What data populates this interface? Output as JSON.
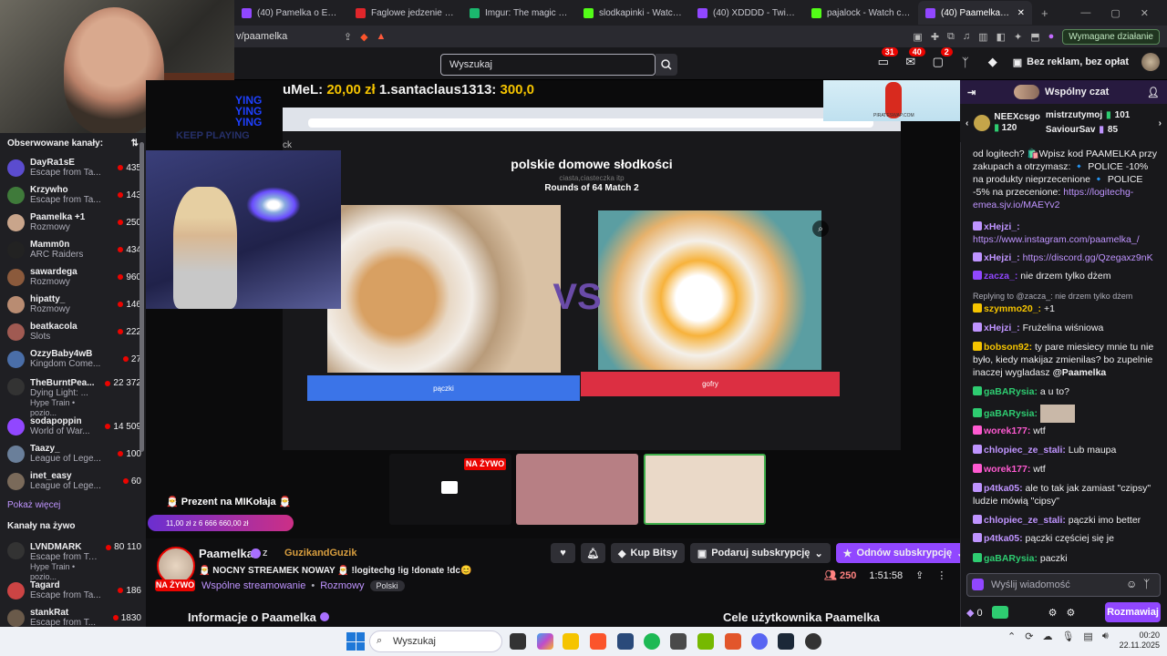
{
  "browser": {
    "tabs": [
      {
        "label": "(40) Pamelka o Ewie - Twit",
        "color": "#9147ff"
      },
      {
        "label": "Faglowe jedzenie | UwUFU",
        "color": "#e0262b"
      },
      {
        "label": "Imgur: The magic of the In",
        "color": "#1bb76e"
      },
      {
        "label": "slodkapinki - Watch clips o",
        "color": "#53fc18"
      },
      {
        "label": "(40) XDDDD - Twitch",
        "color": "#9147ff"
      },
      {
        "label": "pajalock - Watch clips on",
        "color": "#53fc18"
      },
      {
        "label": "(40) Paamelka - Twitch",
        "color": "#9147ff",
        "active": true
      }
    ],
    "new_tab": "+",
    "close": "✕",
    "url": "v/paamelka",
    "required_action": "Wymagane działanie",
    "ext_count": "14"
  },
  "header": {
    "search_placeholder": "Wyszukaj",
    "badge_notifications": "31",
    "badge_inbox": "40",
    "badge_whispers": "2",
    "no_ads": "Bez reklam, bez opłat"
  },
  "sidebar": {
    "followed_title": "Obserwowane kanały:",
    "channels": [
      {
        "name": "DayRa1sE",
        "game": "Escape from Ta...",
        "viewers": "435",
        "color": "#5b4ccf"
      },
      {
        "name": "Krzywho",
        "game": "Escape from Ta...",
        "viewers": "143",
        "color": "#3f7a3a"
      },
      {
        "name": "Paamelka +1",
        "game": "Rozmowy",
        "viewers": "250",
        "color": "#c9a58b"
      },
      {
        "name": "Mamm0n",
        "game": "ARC Raiders",
        "viewers": "434",
        "color": "#222222"
      },
      {
        "name": "sawardega",
        "game": "Rozmowy",
        "viewers": "960",
        "color": "#8b5a3c"
      },
      {
        "name": "hipatty_",
        "game": "Rozmowy",
        "viewers": "146",
        "color": "#b98c72"
      },
      {
        "name": "beatkacola",
        "game": "Slots",
        "viewers": "222",
        "color": "#a05a52"
      },
      {
        "name": "OzzyBaby4wB",
        "game": "Kingdom Come...",
        "viewers": "27",
        "color": "#4a6ea8"
      },
      {
        "name": "TheBurntPea...",
        "game": "Dying Light: ...",
        "viewers": "22 372",
        "color": "#333333",
        "hype": "Hype Train • pozio..."
      },
      {
        "name": "sodapoppin",
        "game": "World of War...",
        "viewers": "14 509",
        "color": "#9147ff"
      },
      {
        "name": "Taazy_",
        "game": "League of Lege...",
        "viewers": "100",
        "color": "#6a7f9a"
      },
      {
        "name": "inet_easy",
        "game": "League of Lege...",
        "viewers": "60",
        "color": "#7a6a5a"
      }
    ],
    "show_more": "Pokaż więcej",
    "live_title": "Kanały na żywo",
    "live_channels": [
      {
        "name": "LVNDMARK",
        "game": "Escape from Ta...",
        "viewers": "80 110",
        "color": "#333333",
        "hype": "Hype Train • pozio..."
      },
      {
        "name": "Tagard",
        "game": "Escape from Ta...",
        "viewers": "186",
        "color": "#c44"
      },
      {
        "name": "stankRat",
        "game": "Escape from T...",
        "viewers": "1830",
        "color": "#6a5a4a"
      }
    ]
  },
  "video": {
    "overlay_top_left": "YING YING YING",
    "keep_playing": "KEEP PLAYING",
    "goal_prefix": "uMeL:",
    "goal_amount1": "20,00 zł",
    "goal_user": "1.santaclaus1313:",
    "goal_amount2": "300,0",
    "ck_label": "ck",
    "page_title": "polskie domowe słodkości",
    "sub_title": "ciasta,ciasteczka itp",
    "round_label": "Rounds of 64 Match 2",
    "vs_label": "VS",
    "left_button": "pączki",
    "right_button": "gofry",
    "live_tag": "NA ŻYWO",
    "gift_label": "🎅 Prezent na MIKołaja 🎅",
    "gift_progress": "11,00 zł z 6 666 660,00 zł",
    "pirate_label": "PIRATESWAP.COM"
  },
  "stream": {
    "name": "Paamelka",
    "with": "z",
    "cohost": "GuzikandGuzik",
    "title": "🎅 NOCNY STREAMEK NOWAY 🎅 !logitechg !ig !donate !dc😊",
    "shared": "Wspólne streamowanie",
    "category": "Rozmowy",
    "tag": "Polski",
    "live_badge": "NA ŻYWO",
    "kup_bitsy": "Kup Bitsy",
    "gift_sub": "Podaruj subskrypcję",
    "renew_sub": "Odnów subskrypcję",
    "viewers": "250",
    "uptime": "1:51:58",
    "about_title": "Informacje o Paamelka",
    "goals_title": "Cele użytkownika Paamelka"
  },
  "chat": {
    "title": "Wspólny czat",
    "leaders": [
      {
        "name": "NEEXcsgo",
        "value": "120"
      },
      {
        "name": "mistrzutymoj",
        "value": "101"
      },
      {
        "name": "SaviourSav",
        "value": "85"
      }
    ],
    "pinned": "od logitech? 🛍️Wpisz kod PAAMELKA przy zakupach a otrzymasz: 🔹 POLICE -10% na produkty nieprzecenione 🔹 POLICE -5% na przecenione:",
    "pinned_link": "https://logitechg-emea.sjv.io/MAEYv2",
    "messages": [
      {
        "user": "xHejzi_:",
        "text": "",
        "link": "https://www.instagram.com/paamelka_/",
        "color": "#bf94ff"
      },
      {
        "user": "xHejzi_:",
        "text": "",
        "link": "https://discord.gg/Qzegaxz9nK",
        "color": "#bf94ff"
      },
      {
        "user": "zacza_:",
        "text": "nie drzem tylko dżem",
        "color": "#9147ff"
      },
      {
        "reply": "Replying to @zacza_: nie drzem tylko dżem"
      },
      {
        "user": "szymmo20_:",
        "text": "+1",
        "color": "#f5c400"
      },
      {
        "user": "xHejzi_:",
        "text": "Frużelina wiśniowa",
        "color": "#bf94ff"
      },
      {
        "user": "bobson92:",
        "text": "ty pare miesiecy mnie tu nie było, kiedy makijaz zmienilas? bo zupelnie inaczej wygladasz",
        "mention": "@Paamelka",
        "color": "#f5c400"
      },
      {
        "user": "gaBARysia:",
        "text": "a u to?",
        "color": "#2ecc71"
      },
      {
        "user": "gaBARysia:",
        "text": "",
        "color": "#2ecc71",
        "emote": true
      },
      {
        "user": "worek177:",
        "text": "wtf",
        "color": "#ff5ad1"
      },
      {
        "user": "chlopiec_ze_stali:",
        "text": "Lub maupa",
        "color": "#bf94ff"
      },
      {
        "user": "worek177:",
        "text": "wtf",
        "color": "#ff5ad1"
      },
      {
        "user": "p4tka05:",
        "text": "ale to tak jak zamiast \"czipsy\" ludzie mówią \"cipsy\"",
        "color": "#bf94ff"
      },
      {
        "user": "chlopiec_ze_stali:",
        "text": "pączki imo better",
        "color": "#bf94ff"
      },
      {
        "user": "p4tka05:",
        "text": "pączki częściej się je",
        "color": "#bf94ff"
      },
      {
        "user": "gaBARysia:",
        "text": "paczki",
        "color": "#2ecc71"
      }
    ],
    "input_placeholder": "Wyślij wiadomość",
    "points": "0",
    "send_button": "Rozmawiaj"
  },
  "taskbar": {
    "search_placeholder": "Wyszukaj",
    "time": "00:20",
    "date": "22.11.2025"
  }
}
